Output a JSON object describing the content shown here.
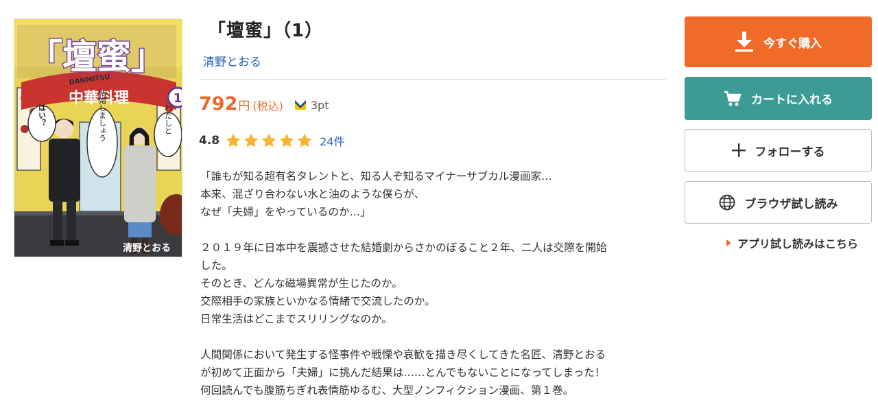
{
  "product": {
    "title": "「壇蜜」（1）",
    "author": "清野とおる",
    "cover": {
      "title_text": "「壇蜜」",
      "romaji": "DANMITSU",
      "volume": "1",
      "author": "清野とおる",
      "sign": "中華料理",
      "bubble_left": "はい？",
      "bubble_mid": "結婚しましょう",
      "bubble_right": "わたしと"
    }
  },
  "price": {
    "value": "792",
    "unit": "円",
    "tax_label": "(税込)",
    "points": "3pt"
  },
  "rating": {
    "score": "4.8",
    "stars": 5,
    "review_count": "24件"
  },
  "description": {
    "lines": [
      "「誰もが知る超有名タレントと、知る人ぞ知るマイナーサブカル漫画家…",
      "本来、混ざり合わない水と油のような僕らが、",
      "なぜ「夫婦」をやっているのか…」",
      "",
      "２０１９年に日本中を震撼させた結婚劇からさかのぼること２年、二人は交際を開始",
      "した。",
      "そのとき、どんな磁場異常が生じたのか。",
      "交際相手の家族といかなる情緒で交流したのか。",
      "日常生活はどこまでスリリングなのか。",
      "",
      "人間関係において発生する怪事件や戦慄や哀歓を描き尽くしてきた名匠、清野とおる",
      "が初めて正面から「夫婦」に挑んだ結果は……とんでもないことになってしまった！",
      "何回読んでも腹筋ちぎれ表情筋ゆるむ、大型ノンフィクション漫画、第１巻。"
    ]
  },
  "actions": {
    "buy_label": "今すぐ購入",
    "cart_label": "カートに入れる",
    "follow_label": "フォローする",
    "browser_read_label": "ブラウザ試し読み",
    "app_read_label": "アプリ試し読みはこちら"
  },
  "colors": {
    "accent_orange": "#f06a2a",
    "cart_teal": "#3d9b95",
    "link_blue": "#2a62b5",
    "star_gold": "#f5b531"
  },
  "icons": {
    "buy": "download-icon",
    "cart": "cart-icon",
    "follow": "plus-icon",
    "browser": "globe-icon",
    "points": "point-badge-icon",
    "app_link": "triangle-right-icon"
  }
}
